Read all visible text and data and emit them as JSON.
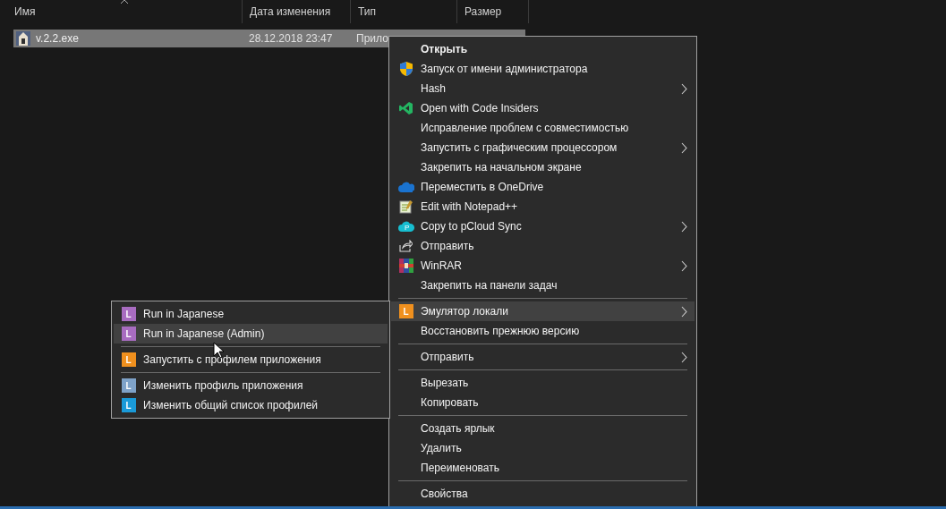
{
  "columns": [
    {
      "label": "Имя",
      "sorted": true
    },
    {
      "label": "Дата изменения",
      "sorted": false
    },
    {
      "label": "Тип",
      "sorted": false
    },
    {
      "label": "Размер",
      "sorted": false
    }
  ],
  "file": {
    "name": "v.2.2.exe",
    "date": "28.12.2018 23:47",
    "type": "Прило",
    "selected": true
  },
  "context_menu": [
    {
      "kind": "item",
      "label": "Открыть",
      "bold": true,
      "submenu": false,
      "selected": false
    },
    {
      "kind": "item",
      "label": "Запуск от имени администратора",
      "bold": false,
      "submenu": false,
      "selected": false
    },
    {
      "kind": "item",
      "label": "Hash",
      "bold": false,
      "submenu": true,
      "selected": false
    },
    {
      "kind": "item",
      "label": "Open with Code Insiders",
      "bold": false,
      "submenu": false,
      "selected": false
    },
    {
      "kind": "item",
      "label": "Исправление проблем с совместимостью",
      "bold": false,
      "submenu": false,
      "selected": false
    },
    {
      "kind": "item",
      "label": "Запустить с графическим процессором",
      "bold": false,
      "submenu": true,
      "selected": false
    },
    {
      "kind": "item",
      "label": "Закрепить на начальном экране",
      "bold": false,
      "submenu": false,
      "selected": false
    },
    {
      "kind": "item",
      "label": "Переместить в OneDrive",
      "bold": false,
      "submenu": false,
      "selected": false
    },
    {
      "kind": "item",
      "label": "Edit with Notepad++",
      "bold": false,
      "submenu": false,
      "selected": false
    },
    {
      "kind": "item",
      "label": "Copy to pCloud Sync",
      "icon_text": "P",
      "bold": false,
      "submenu": true,
      "selected": false
    },
    {
      "kind": "item",
      "label": "Отправить",
      "bold": false,
      "submenu": false,
      "selected": false
    },
    {
      "kind": "item",
      "label": "WinRAR",
      "bold": false,
      "submenu": true,
      "selected": false
    },
    {
      "kind": "item",
      "label": "Закрепить на панели задач",
      "bold": false,
      "submenu": false,
      "selected": false
    },
    {
      "kind": "separator"
    },
    {
      "kind": "item",
      "label": "Эмулятор локали",
      "icon_text": "L",
      "color": "#f0901e",
      "bold": false,
      "submenu": true,
      "selected": true
    },
    {
      "kind": "item",
      "label": "Восстановить прежнюю версию",
      "bold": false,
      "submenu": false,
      "selected": false
    },
    {
      "kind": "separator"
    },
    {
      "kind": "item",
      "label": "Отправить",
      "bold": false,
      "submenu": true,
      "selected": false
    },
    {
      "kind": "separator"
    },
    {
      "kind": "item",
      "label": "Вырезать",
      "bold": false,
      "submenu": false,
      "selected": false
    },
    {
      "kind": "item",
      "label": "Копировать",
      "bold": false,
      "submenu": false,
      "selected": false
    },
    {
      "kind": "separator"
    },
    {
      "kind": "item",
      "label": "Создать ярлык",
      "bold": false,
      "submenu": false,
      "selected": false
    },
    {
      "kind": "item",
      "label": "Удалить",
      "bold": false,
      "submenu": false,
      "selected": false
    },
    {
      "kind": "item",
      "label": "Переименовать",
      "bold": false,
      "submenu": false,
      "selected": false
    },
    {
      "kind": "separator"
    },
    {
      "kind": "item",
      "label": "Свойства",
      "bold": false,
      "submenu": false,
      "selected": false
    }
  ],
  "submenu": [
    {
      "kind": "item",
      "label": "Run in Japanese",
      "icon_text": "L",
      "color": "#a86cc0",
      "selected": false
    },
    {
      "kind": "item",
      "label": "Run in Japanese (Admin)",
      "icon_text": "L",
      "color": "#a86cc0",
      "selected": true
    },
    {
      "kind": "separator"
    },
    {
      "kind": "item",
      "label": "Запустить с профилем приложения",
      "icon_text": "L",
      "color": "#f0901e",
      "selected": false
    },
    {
      "kind": "separator"
    },
    {
      "kind": "item",
      "label": "Изменить профиль приложения",
      "icon_text": "L",
      "color": "#7ea2c8",
      "selected": false
    },
    {
      "kind": "item",
      "label": "Изменить общий список профилей",
      "icon_text": "L",
      "color": "#1a9ad8",
      "selected": false
    }
  ]
}
